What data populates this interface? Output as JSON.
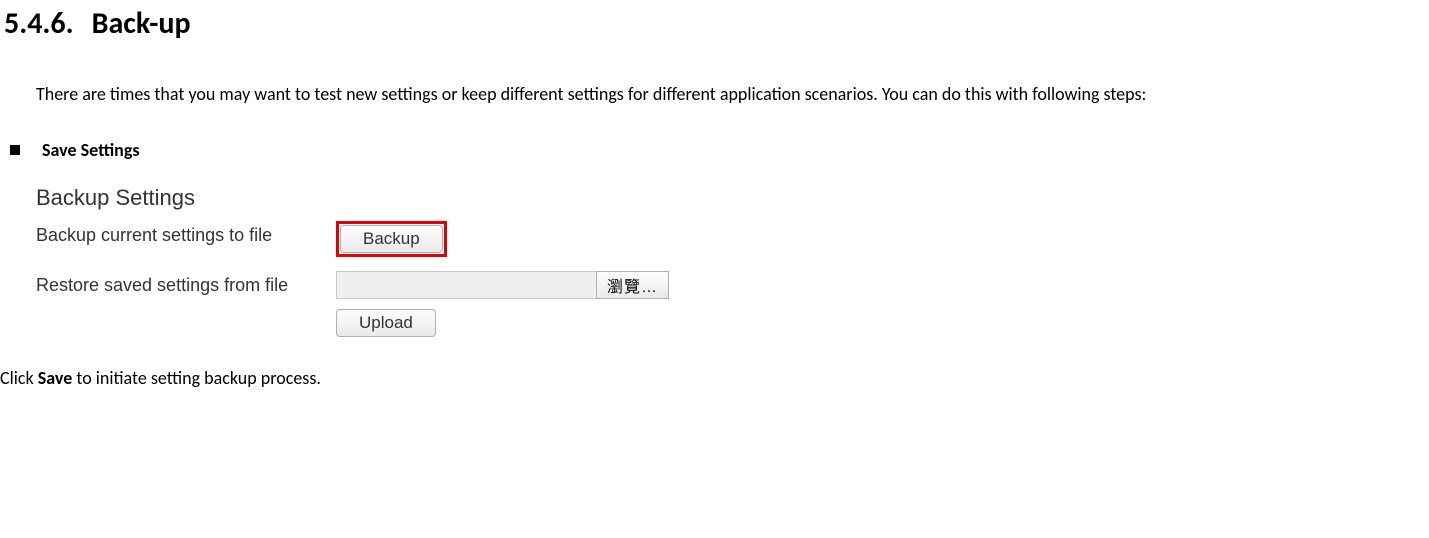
{
  "heading": {
    "number": "5.4.6.",
    "title": "Back-up"
  },
  "intro": "There are times that you may want to test new settings or keep different settings for different application scenarios. You can do this with following steps:",
  "bullet": {
    "label": "Save Settings"
  },
  "panel": {
    "title": "Backup Settings",
    "backup_row_label": "Backup current settings to file",
    "backup_button": "Backup",
    "restore_row_label": "Restore saved settings from file",
    "browse_button": "瀏覽…",
    "upload_button": "Upload"
  },
  "closing": {
    "pre": "Click ",
    "bold": "Save",
    "post": " to initiate setting backup process."
  }
}
